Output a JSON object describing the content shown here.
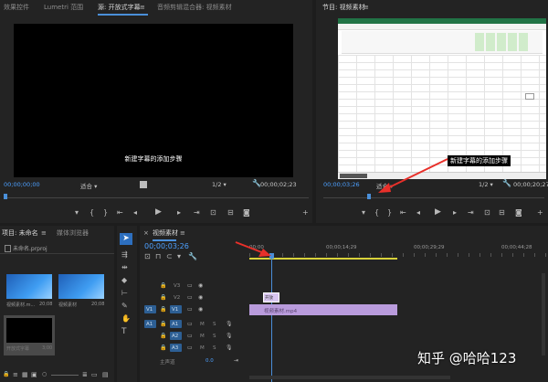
{
  "source_monitor": {
    "tabs": [
      "效果控件",
      "Lumetri 范围",
      "源: 开放式字幕",
      "音频剪辑混合器: 视频素材"
    ],
    "active_tab": 2,
    "caption": "新建字幕的添加步骤",
    "timecode_left": "00;00;00;00",
    "fit": "适合",
    "resolution": "1/2",
    "timecode_right": "00;00;02;23"
  },
  "program_monitor": {
    "title": "节目: 视频素材",
    "caption": "新建字幕的添加步骤",
    "timecode_left": "00;00;03;26",
    "fit": "适合",
    "resolution": "1/2",
    "timecode_right": "00;00;20;27"
  },
  "project_panel": {
    "tabs": [
      "项目: 未命名",
      "媒体浏览器"
    ],
    "project_file": "未命名.prproj",
    "items": [
      {
        "name": "视频素材.m...",
        "duration": "20;08"
      },
      {
        "name": "视频素材",
        "duration": "20;08"
      },
      {
        "name": "开放式字幕",
        "duration": "3;00"
      }
    ]
  },
  "timeline": {
    "title": "视频素材",
    "timecode": "00;00;03;26",
    "ruler": [
      "00;00",
      "00;00;14;29",
      "00;00;29;29",
      "00;00;44;28"
    ],
    "video_tracks": [
      "V3",
      "V2",
      "V1"
    ],
    "audio_tracks": [
      "A1",
      "A2",
      "A3"
    ],
    "source_patch_v": "V1",
    "source_patch_a": "A1",
    "master_label": "主声道",
    "master_value": "0.0",
    "clip_label": "视频素材.mp4",
    "caption_clip_label": "开放"
  },
  "watermark": "知乎 @哈哈123",
  "colors": {
    "accent": "#4a8fd9",
    "clip_purple": "#b99bdc",
    "caption_clip": "#d8c6f0",
    "work_area": "#d8d23a",
    "arrow": "#e8302a"
  },
  "icons": [
    "selection-tool-icon",
    "track-select-icon",
    "ripple-edit-icon",
    "razor-icon",
    "slip-icon",
    "pen-icon",
    "hand-icon",
    "type-icon",
    "wrench-icon",
    "play-icon",
    "step-back-icon",
    "step-forward-icon",
    "mark-in-icon",
    "mark-out-icon",
    "export-frame-icon",
    "lock-icon",
    "eye-icon",
    "mute-icon",
    "solo-icon",
    "mic-icon"
  ]
}
